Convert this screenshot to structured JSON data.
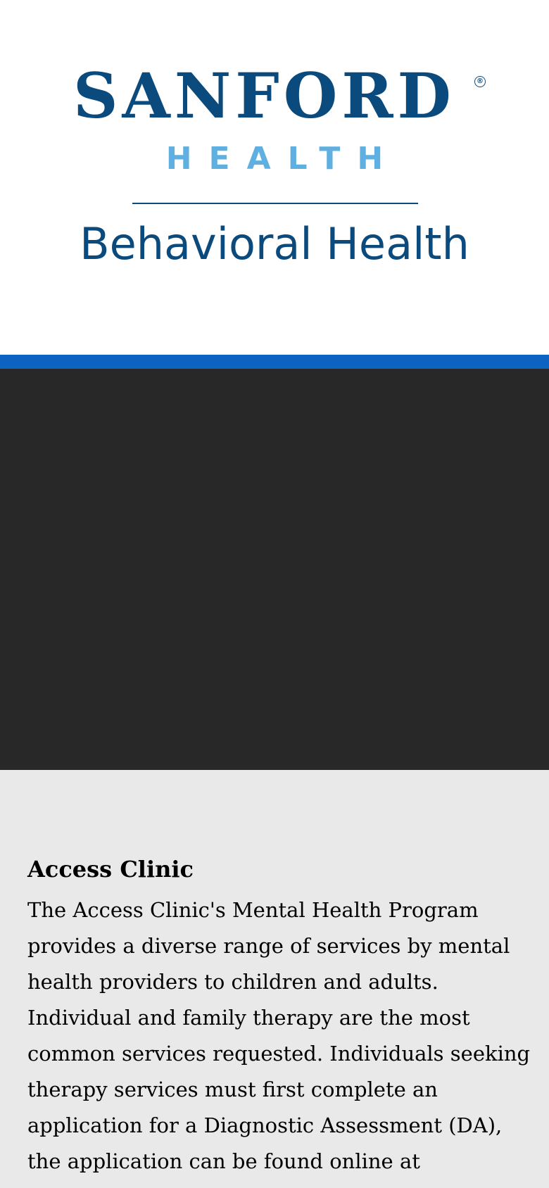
{
  "header": {
    "brand_name": "SANFORD",
    "registered_mark": "®",
    "brand_sub": "HEALTH",
    "division": "Behavioral Health"
  },
  "colors": {
    "brand_navy": "#0b4a7c",
    "brand_light_blue": "#5fb0e0",
    "accent_blue": "#0d63c0",
    "media_background": "#282828",
    "content_background": "#e9e9e9"
  },
  "content": {
    "title": "Access Clinic",
    "body": "The Access Clinic's Mental Health Program provides a diverse range of services by mental health providers to children and adults. Individual and family therapy are the most common services requested. Individuals seeking therapy services must first complete an application for a Diagnostic Assessment (DA), the application can be found online at sanfordhealth.org/behavioralhealth/access"
  }
}
